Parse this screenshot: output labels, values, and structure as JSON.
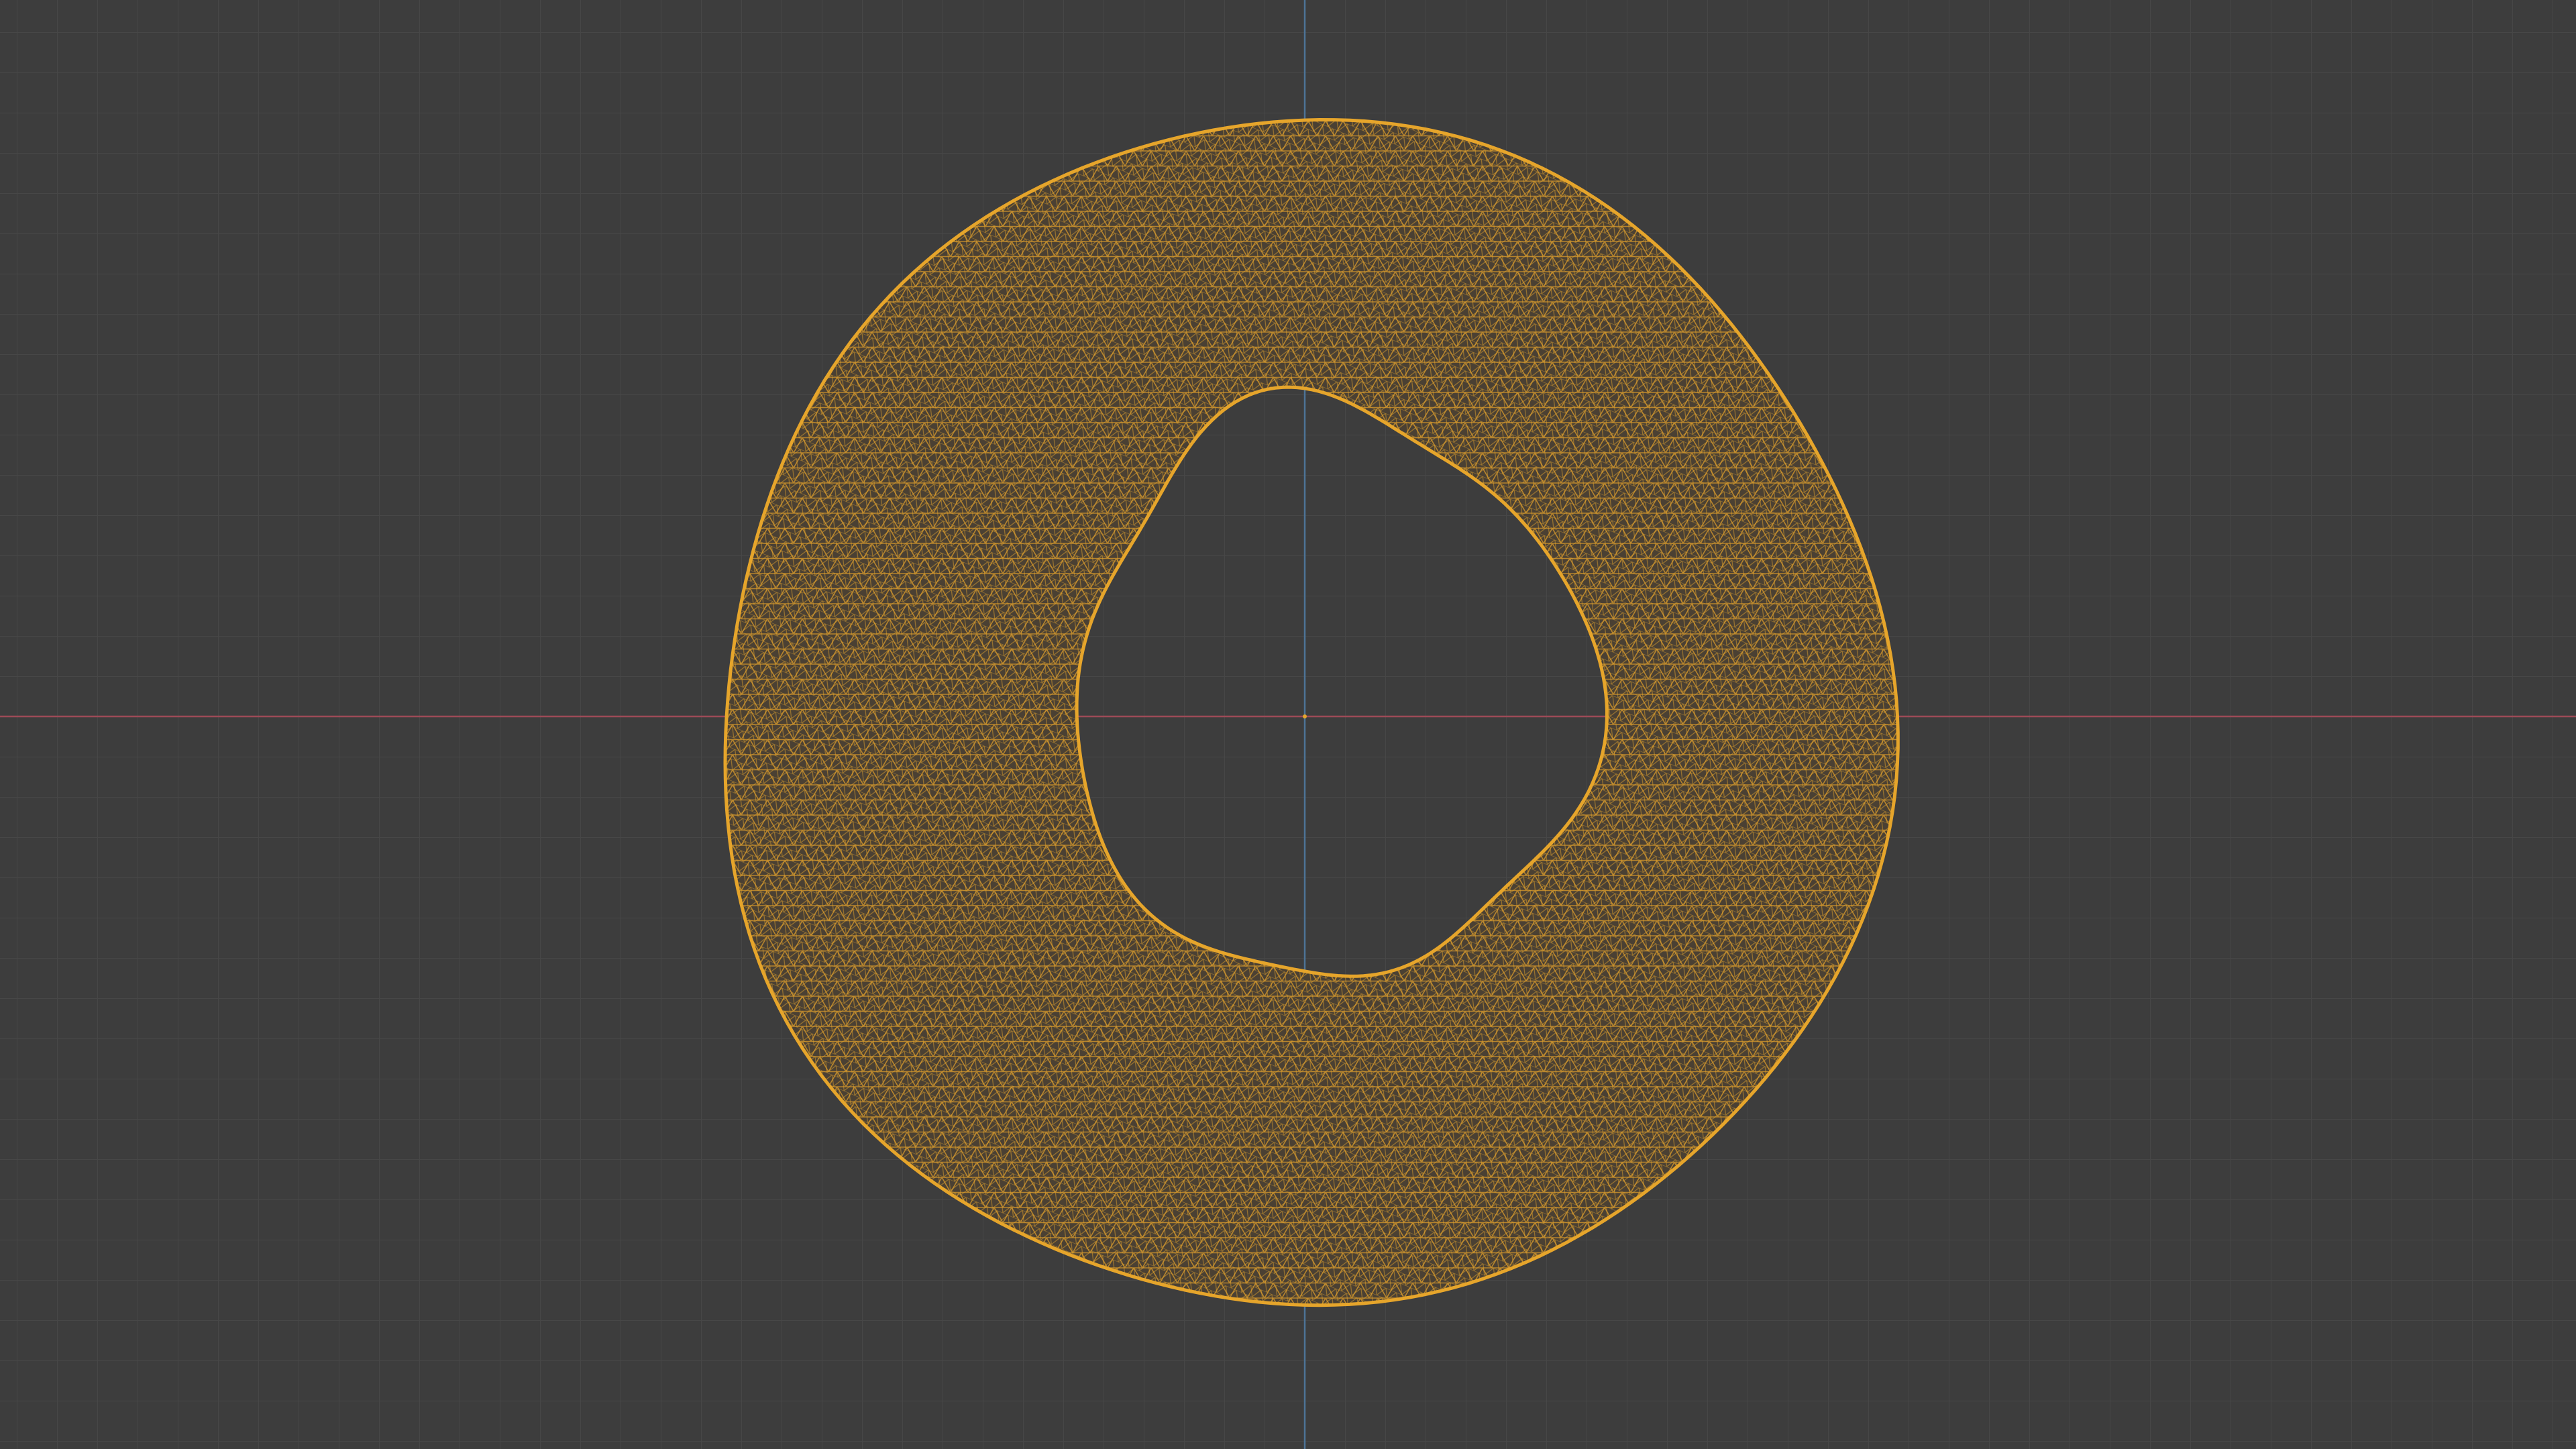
{
  "viewport": {
    "view": "top-orthographic",
    "shading": "wireframe",
    "background_color": "#3d3d3d",
    "grid_color": "#474747",
    "grid_major_color": "#4d4d4d",
    "x_axis_color": "#9c4a57",
    "y_axis_color": "#4d7396",
    "wireframe_color": "#e6a52b",
    "mesh_fill_color": "#4f4434",
    "object": {
      "name_icon": "torus-mesh-icon",
      "selected": true
    }
  }
}
